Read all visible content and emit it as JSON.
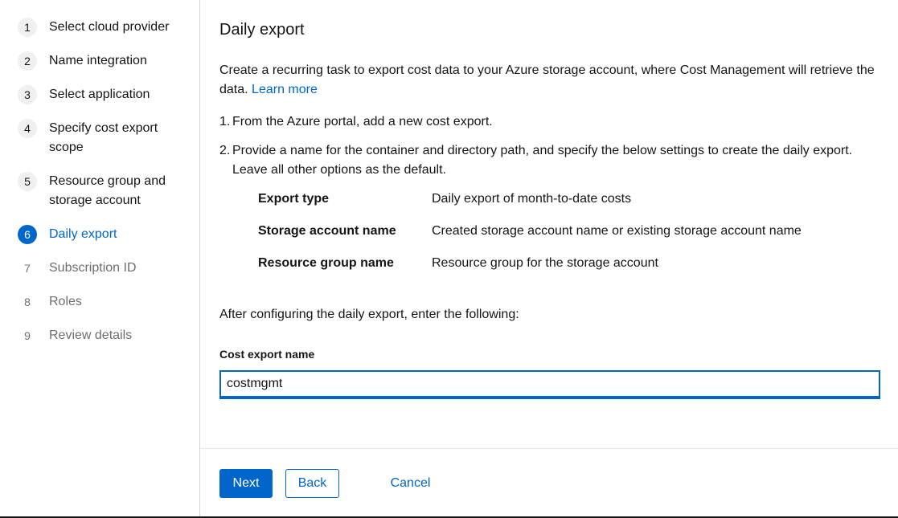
{
  "nav": {
    "items": [
      {
        "num": "1",
        "label": "Select cloud provider",
        "state": "visited"
      },
      {
        "num": "2",
        "label": "Name integration",
        "state": "visited"
      },
      {
        "num": "3",
        "label": "Select application",
        "state": "visited"
      },
      {
        "num": "4",
        "label": "Specify cost export scope",
        "state": "visited"
      },
      {
        "num": "5",
        "label": "Resource group and storage account",
        "state": "visited"
      },
      {
        "num": "6",
        "label": "Daily export",
        "state": "current"
      },
      {
        "num": "7",
        "label": "Subscription ID",
        "state": "disabled"
      },
      {
        "num": "8",
        "label": "Roles",
        "state": "disabled"
      },
      {
        "num": "9",
        "label": "Review details",
        "state": "disabled"
      }
    ]
  },
  "main": {
    "title": "Daily export",
    "intro_text": "Create a recurring task to export cost data to your Azure storage account, where Cost Management will retrieve the data.",
    "learn_more": "Learn more",
    "steps": [
      {
        "num": "1.",
        "text": "From the Azure portal, add a new cost export."
      },
      {
        "num": "2.",
        "text": "Provide a name for the container and directory path, and specify the below settings to create the daily export. Leave all other options as the default."
      }
    ],
    "settings": [
      {
        "key": "Export type",
        "value": "Daily export of month-to-date costs"
      },
      {
        "key": "Storage account name",
        "value": "Created storage account name or existing storage account name"
      },
      {
        "key": "Resource group name",
        "value": "Resource group for the storage account"
      }
    ],
    "after_text": "After configuring the daily export, enter the following:",
    "field_label": "Cost export name",
    "field_value": "costmgmt"
  },
  "footer": {
    "next": "Next",
    "back": "Back",
    "cancel": "Cancel"
  },
  "colors": {
    "accent": "#0066cc",
    "text": "#151515",
    "muted": "#6a6e73"
  }
}
